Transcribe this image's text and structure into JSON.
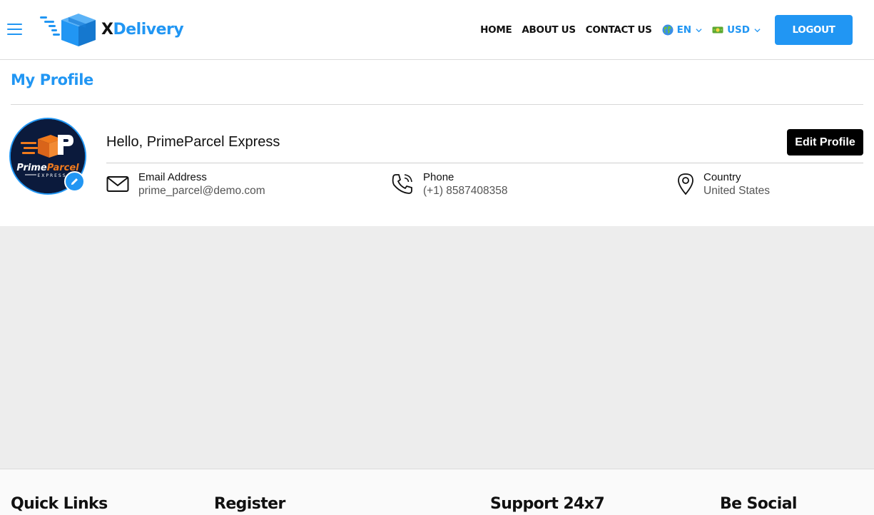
{
  "header": {
    "brand_x": "X",
    "brand_rest": "Delivery",
    "nav": [
      "HOME",
      "ABOUT US",
      "CONTACT US"
    ],
    "language": "EN",
    "currency": "USD",
    "logout_label": "LOGOUT",
    "accent_color": "#2196f3"
  },
  "profile": {
    "page_title": "My Profile",
    "greeting": "Hello, PrimeParcel Express",
    "edit_button": "Edit Profile",
    "avatar_logo": "PrimeParcel EXPRESS",
    "email_label": "Email Address",
    "email_value": "prime_parcel@demo.com",
    "phone_label": "Phone",
    "phone_value": "(+1) 8587408358",
    "country_label": "Country",
    "country_value": "United States"
  },
  "footer": {
    "headings": [
      "Quick Links",
      "Register",
      "Support 24x7",
      "Be Social"
    ]
  },
  "icons": [
    "hamburger-icon",
    "delivery-box-logo-icon",
    "globe-icon",
    "money-icon",
    "chevron-down-icon",
    "pencil-icon",
    "mail-icon",
    "phone-icon",
    "location-pin-icon"
  ]
}
